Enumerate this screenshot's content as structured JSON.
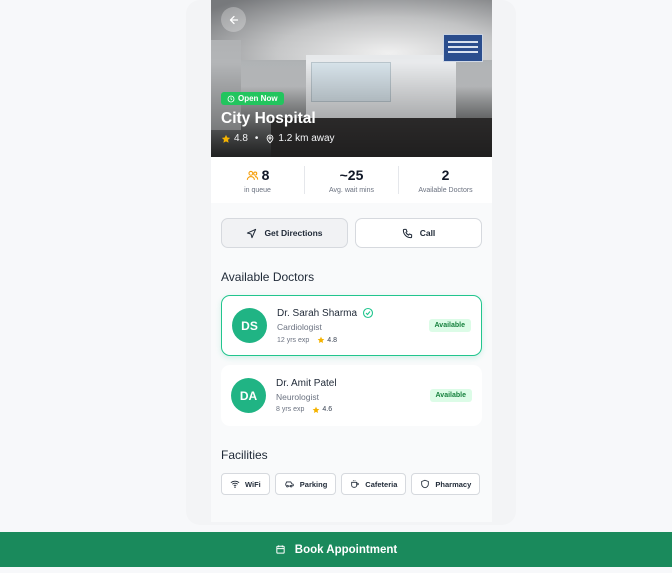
{
  "hospital": {
    "status": "Open Now",
    "name": "City Hospital",
    "rating": "4.8",
    "separator": "•",
    "distance": "1.2 km away"
  },
  "stats": [
    {
      "value": "8",
      "label": "in queue",
      "icon": "people-icon"
    },
    {
      "value": "~25",
      "label": "Avg. wait mins"
    },
    {
      "value": "2",
      "label": "Available Doctors"
    }
  ],
  "actions": {
    "directions_label": "Get Directions",
    "call_label": "Call"
  },
  "doctors_section": {
    "title": "Available Doctors"
  },
  "doctors": [
    {
      "initials": "DS",
      "name": "Dr. Sarah Sharma",
      "specialty": "Cardiologist",
      "experience": "12 yrs exp",
      "rating": "4.8",
      "status": "Available",
      "verified": true,
      "selected": true
    },
    {
      "initials": "DA",
      "name": "Dr. Amit Patel",
      "specialty": "Neurologist",
      "experience": "8 yrs exp",
      "rating": "4.6",
      "status": "Available",
      "verified": false,
      "selected": false
    }
  ],
  "facilities_section": {
    "title": "Facilities"
  },
  "facilities": [
    {
      "label": "WiFi",
      "icon": "wifi-icon"
    },
    {
      "label": "Parking",
      "icon": "car-icon"
    },
    {
      "label": "Cafeteria",
      "icon": "coffee-icon"
    },
    {
      "label": "Pharmacy",
      "icon": "shield-icon"
    }
  ],
  "book_button": {
    "label": "Book Appointment",
    "icon": "calendar-icon"
  },
  "colors": {
    "primary": "#1a8a5c",
    "accent": "#22c55e",
    "star": "#f5b301",
    "avatar": "#20b484"
  }
}
